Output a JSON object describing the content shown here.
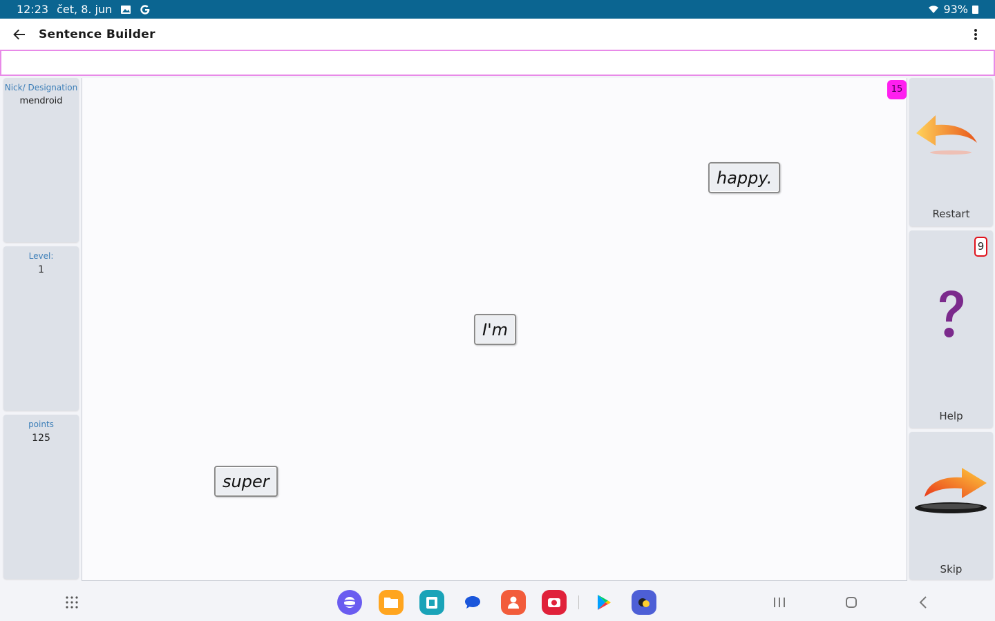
{
  "status": {
    "time": "12:23",
    "date": "čet, 8. jun",
    "battery": "93%"
  },
  "appbar": {
    "title": "Sentence Builder"
  },
  "left_panel": {
    "nick_label": "Nick/ Designation",
    "nick_value": "mendroid",
    "level_label": "Level:",
    "level_value": "1",
    "points_label": "points",
    "points_value": "125"
  },
  "game": {
    "counter": "15",
    "help_count": "9",
    "words": [
      "happy.",
      "I'm",
      "super"
    ]
  },
  "actions": {
    "restart_label": "Restart",
    "help_label": "Help",
    "skip_label": "Skip"
  },
  "colors": {
    "status_bar": "#0b6591",
    "answer_border": "#e88ae8",
    "counter_badge": "#ff1ff0",
    "help_badge_border": "#e0121c",
    "question_mark": "#7b2a8c",
    "arrow_orange": "#f39a1b"
  }
}
